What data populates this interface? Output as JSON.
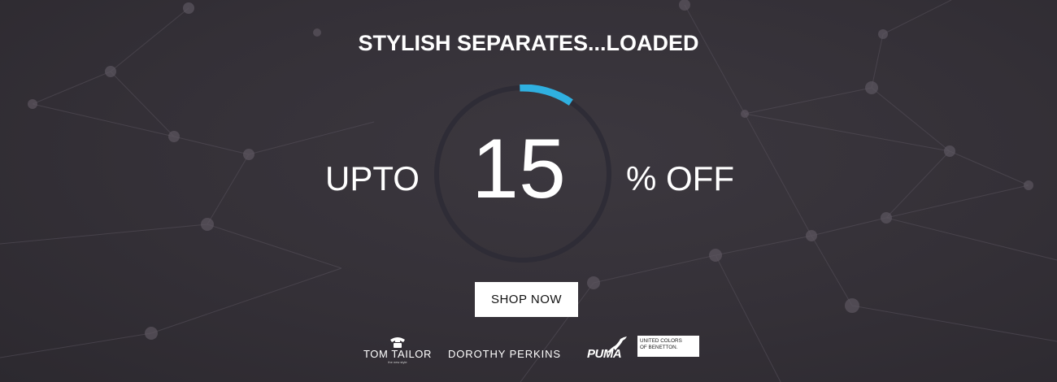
{
  "banner": {
    "headline": "STYLISH SEPARATES...LOADED",
    "prefix": "UPTO",
    "discount_value": "15",
    "suffix": "% OFF",
    "progress_ring_fill": 0.1,
    "accent_color": "#2fb0e0",
    "cta_label": "SHOP NOW"
  },
  "brands": {
    "tom_tailor": {
      "name": "TOM TAILOR",
      "tagline": "the new style",
      "icon": "rotary-phone-icon"
    },
    "dorothy_perkins": {
      "name": "DOROTHY PERKINS"
    },
    "puma": {
      "name": "PUMA",
      "icon": "leaping-cat-icon"
    },
    "benetton": {
      "line1": "UNITED COLORS",
      "line2": "OF BENETTON."
    }
  }
}
